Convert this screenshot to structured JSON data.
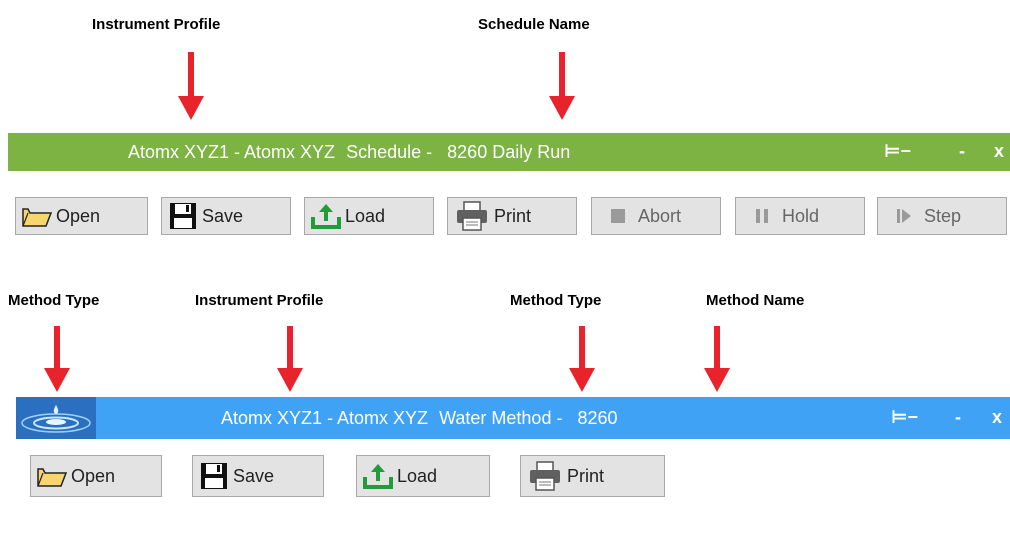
{
  "top": {
    "callouts": [
      "Instrument Profile",
      "Schedule Name"
    ],
    "titlebar": {
      "profile": "Atomx XYZ1 - Atomx XYZ",
      "section": "Schedule -",
      "name": "8260 Daily Run",
      "pin": "⊨−",
      "minimize": "-",
      "close": "x",
      "color": "#7cb342"
    },
    "toolbar": [
      "Open",
      "Save",
      "Load",
      "Print",
      "Abort",
      "Hold",
      "Step"
    ]
  },
  "bottom": {
    "callouts": [
      "Method Type",
      "Instrument Profile",
      "Method Type",
      "Method Name"
    ],
    "titlebar": {
      "profile": "Atomx XYZ1 - Atomx XYZ",
      "section": "Water Method -",
      "name": "8260",
      "pin": "⊨−",
      "minimize": "-",
      "close": "x",
      "color": "#3fa2f5"
    },
    "toolbar": [
      "Open",
      "Save",
      "Load",
      "Print"
    ]
  },
  "accent": {
    "arrow": "#e8232b"
  }
}
